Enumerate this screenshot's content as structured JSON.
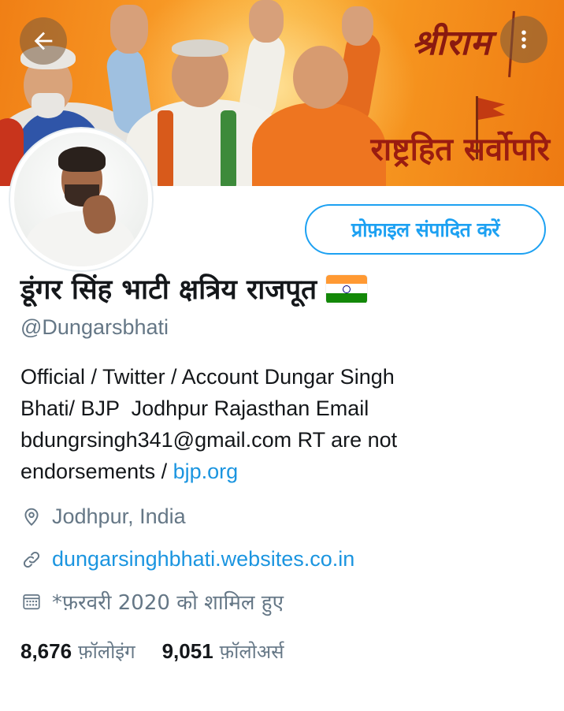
{
  "banner": {
    "title_text": "श्रीराम",
    "slogan_text": "राष्ट्रहित सर्वोपरि"
  },
  "toolbar": {
    "back_icon": "arrow-left-icon",
    "more_icon": "more-vertical-icon"
  },
  "profile": {
    "edit_button_label": "प्रोफ़ाइल संपादित करें",
    "display_name": "डूंगर सिंह भाटी क्षत्रिय राजपूत",
    "name_emoji": "india-flag",
    "handle": "@Dungarsbhati",
    "bio_lines": [
      "Official / Twitter / Account Dungar Singh",
      "Bhati/ BJP  Jodhpur Rajasthan Email",
      "bdungrsingh341@gmail.com RT are not",
      "endorsements / "
    ],
    "bio_link": "bjp.org",
    "location": "Jodhpur, India",
    "website": "dungarsinghbhati.websites.co.in",
    "joined": "*फ़रवरी 2020 को शामिल हुए",
    "following_count": "8,676",
    "following_label": "फ़ॉलोइंग",
    "followers_count": "9,051",
    "followers_label": "फ़ॉलोअर्स"
  },
  "colors": {
    "accent": "#1da1f2",
    "link": "#1b95e0",
    "secondary_text": "#657786",
    "primary_text": "#14171a",
    "banner_orange": "#f39322"
  }
}
